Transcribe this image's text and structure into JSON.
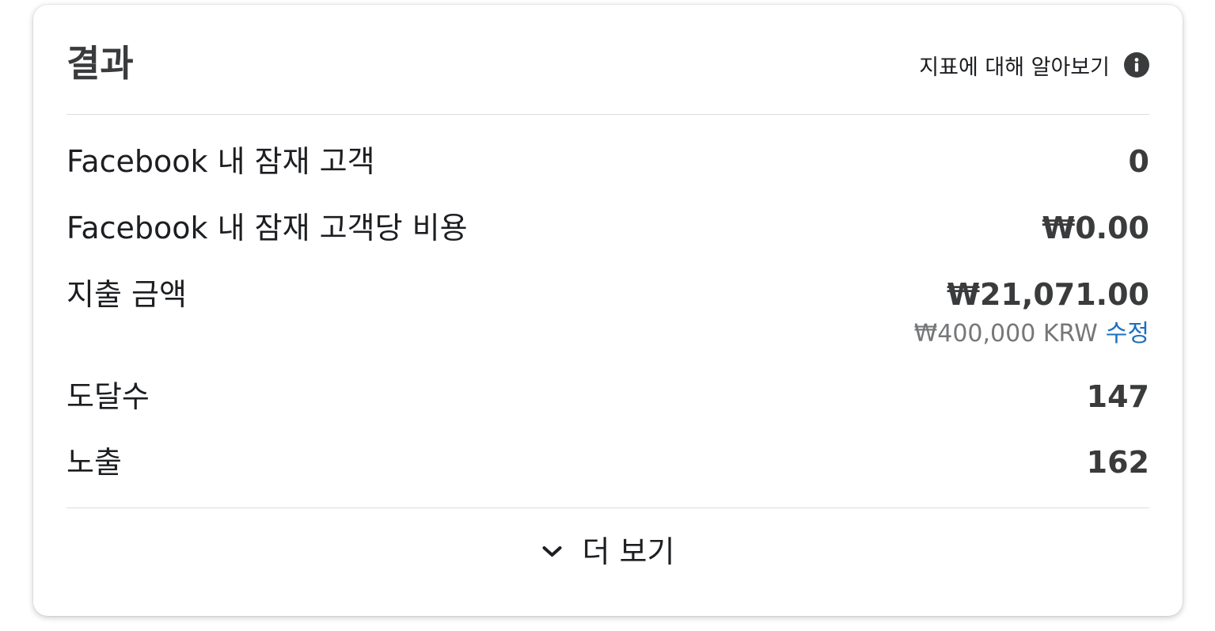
{
  "card": {
    "title": "결과",
    "learn_link": "지표에 대해 알아보기",
    "info_icon": "info-icon"
  },
  "metrics": [
    {
      "label": "Facebook 내 잠재 고객",
      "value": "0"
    },
    {
      "label": "Facebook 내 잠재 고객당 비용",
      "value": "₩0.00"
    },
    {
      "label": "지출 금액",
      "value": "₩21,071.00"
    },
    {
      "label": "도달수",
      "value": "147"
    },
    {
      "label": "노출",
      "value": "162"
    }
  ],
  "budget": {
    "amount": "₩400,000 KRW",
    "edit_label": "수정"
  },
  "footer": {
    "more_label": "더 보기",
    "more_icon": "chevron-down-icon"
  },
  "colors": {
    "link": "#1f6fbf",
    "muted": "#757779",
    "value": "#3a3b3c",
    "divider": "#dadde1"
  }
}
